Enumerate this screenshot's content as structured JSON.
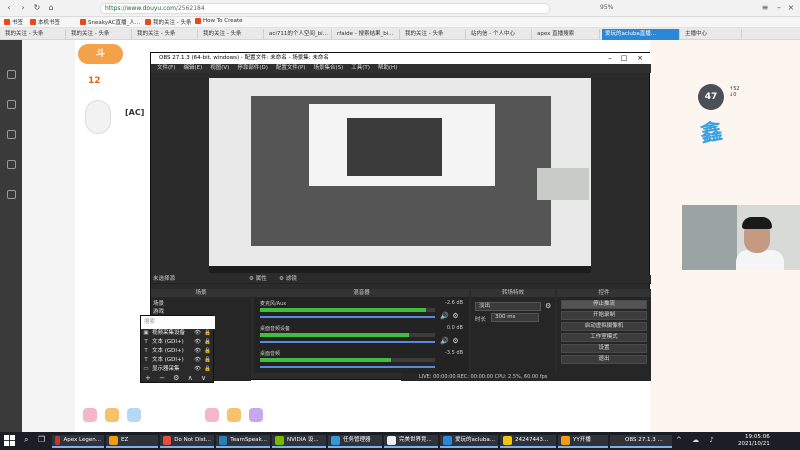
{
  "browser": {
    "url_host": "https://www.douyu.com",
    "url_path": "/2562184",
    "zoom": "95%",
    "bookmarks": [
      "书签",
      "本机书签",
      "SneakyAC直播_人...",
      "我的关注 - 头条",
      "How To Create"
    ],
    "tabs": [
      {
        "label": "我的关注 - 头条",
        "active": false
      },
      {
        "label": "我的关注 - 头条",
        "active": false
      },
      {
        "label": "我的关注 - 头条",
        "active": false
      },
      {
        "label": "我的关注 - 头条",
        "active": false
      },
      {
        "label": "aci711的个人空间_bi...",
        "active": false
      },
      {
        "label": "rfaide - 搜索结果_bi...",
        "active": false
      },
      {
        "label": "我的关注 - 头条",
        "active": false
      },
      {
        "label": "站内信 - 个人中心",
        "active": false
      },
      {
        "label": "apex 直播搜索",
        "active": false
      },
      {
        "label": "爱玩的acluba直播...",
        "active": true
      },
      {
        "label": "主播中心",
        "active": false
      }
    ]
  },
  "stream_page": {
    "fan_count": "12",
    "anchor_tag": "[AC]",
    "gauge_value": "47",
    "gauge_speed_up": "52",
    "gauge_speed_down": "0"
  },
  "obs": {
    "title": "OBS 27.1.3 (64-bit, windows) - 配置文件: 未命名 - 场景集: 未命名",
    "menu": [
      "文件(F)",
      "编辑(E)",
      "视图(V)",
      "停靠部件(D)",
      "配置文件(P)",
      "场景集合(S)",
      "工具(T)",
      "帮助(H)"
    ],
    "status_left": "未选择源",
    "status_btns": [
      "属性",
      "滤镜"
    ],
    "docks": [
      "场景",
      "来源",
      "混音器",
      "转场特效",
      "控件"
    ],
    "scenes": [
      "场景",
      "游戏"
    ],
    "search_placeholder": "搜索",
    "sources": [
      {
        "icon": "▣",
        "name": "视频采集设备"
      },
      {
        "icon": "T",
        "name": "文本 (GDI+)"
      },
      {
        "icon": "T",
        "name": "文本 (GDI+)"
      },
      {
        "icon": "T",
        "name": "文本 (GDI+)"
      },
      {
        "icon": "▭",
        "name": "显示器采集"
      }
    ],
    "source_tools": "+ − ⚙ ∧ ∨",
    "mixer": [
      {
        "name": "麦克风/Aux",
        "db": "-2.6 dB",
        "level": 0.95
      },
      {
        "name": "桌面音频设备",
        "db": "0.0 dB",
        "level": 0.85
      },
      {
        "name": "桌面音频",
        "db": "-3.5 dB",
        "level": 0.75
      }
    ],
    "transition": "淡出",
    "duration_label": "时长",
    "duration": "300 ms",
    "controls": [
      "停止推流",
      "开始录制",
      "启动虚拟摄像机",
      "工作室模式",
      "设置",
      "退出"
    ],
    "footer": "LIVE: 00:00:00   REC: 00:00:00   CPU: 2.5%, 60.00 fps"
  },
  "taskbar": {
    "items": [
      {
        "label": "Apex Legen...",
        "color": "#c0392b"
      },
      {
        "label": "EZ",
        "color": "#f39c12"
      },
      {
        "label": "Do Not Dist...",
        "color": "#e74c3c"
      },
      {
        "label": "TeamSpeak...",
        "color": "#2980b9"
      },
      {
        "label": "NVIDIA 设...",
        "color": "#76b900"
      },
      {
        "label": "任务管理器",
        "color": "#3498db"
      },
      {
        "label": "完美世界竞...",
        "color": "#ecf0f1"
      },
      {
        "label": "爱玩的acluba...",
        "color": "#2c87d6"
      },
      {
        "label": "24247443...",
        "color": "#f1c40f"
      },
      {
        "label": "YY开播",
        "color": "#f39c12"
      },
      {
        "label": "OBS 27.1.3 ...",
        "color": "#333333"
      }
    ],
    "time": "19:05:06",
    "date": "2021/10/21"
  },
  "colors": {
    "obs_bg": "#2b2b2b",
    "accent_tab": "#2c87d6",
    "meter_green": "#3fbf3f"
  }
}
